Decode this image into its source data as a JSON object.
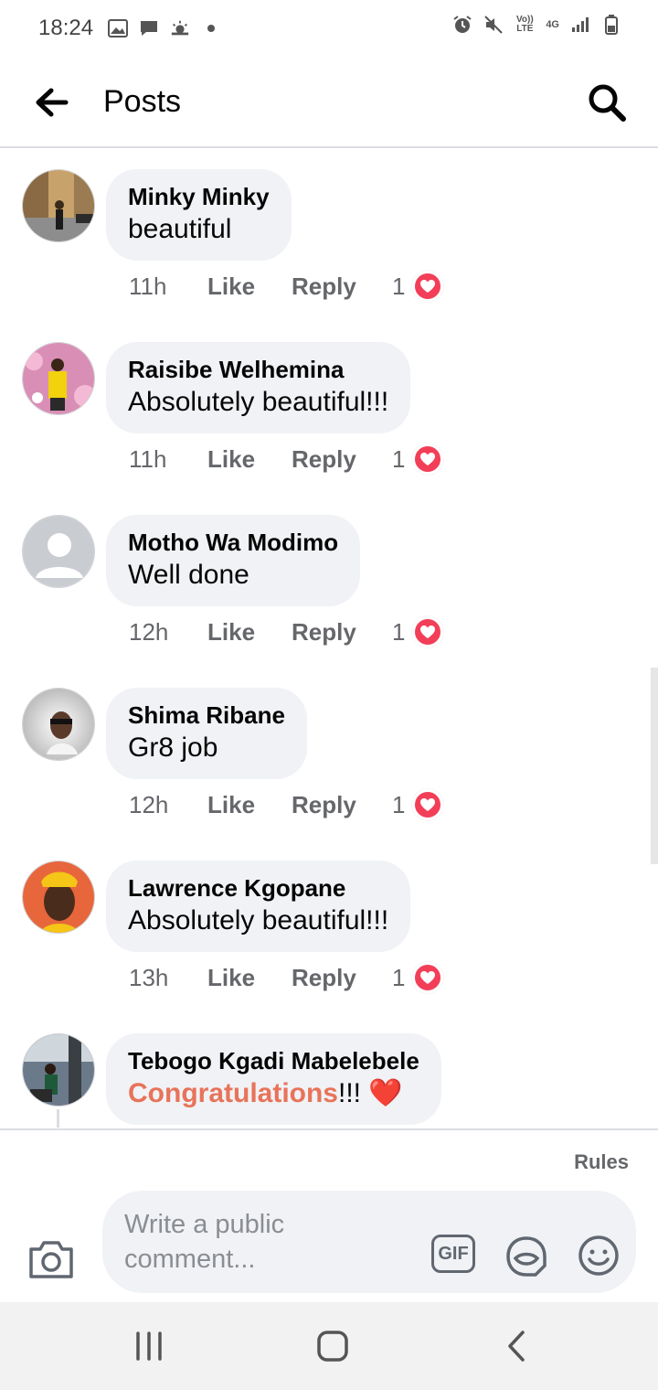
{
  "status_bar": {
    "time": "18:24",
    "volte_label": "Vo)) LTE",
    "network_label": "4G"
  },
  "app_bar": {
    "title": "Posts",
    "back_icon": "arrow-left-icon",
    "search_icon": "search-icon"
  },
  "comments": [
    {
      "name": "Minky Minky",
      "text": "beautiful",
      "time": "11h",
      "like": "Like",
      "reply": "Reply",
      "reactions": "1"
    },
    {
      "name": "Raisibe Welhemina",
      "text": "Absolutely beautiful!!!",
      "time": "11h",
      "like": "Like",
      "reply": "Reply",
      "reactions": "1"
    },
    {
      "name": "Motho Wa Modimo",
      "text": "Well done",
      "time": "12h",
      "like": "Like",
      "reply": "Reply",
      "reactions": "1"
    },
    {
      "name": "Shima Ribane",
      "text": "Gr8 job",
      "time": "12h",
      "like": "Like",
      "reply": "Reply",
      "reactions": "1"
    },
    {
      "name": "Lawrence Kgopane",
      "text": "Absolutely beautiful!!!",
      "time": "13h",
      "like": "Like",
      "reply": "Reply",
      "reactions": "1"
    },
    {
      "name": "Tebogo Kgadi Mabelebele",
      "text_highlight": "Congratulations",
      "text_rest": "!!!",
      "emoji": "❤️"
    }
  ],
  "composer": {
    "rules_label": "Rules",
    "placeholder": "Write a public comment...",
    "gif_label": "GIF"
  },
  "colors": {
    "bubble_bg": "#f0f2f5",
    "reaction_red": "#f33e58",
    "highlight_text": "#e8735a",
    "secondary_text": "#65676b"
  }
}
